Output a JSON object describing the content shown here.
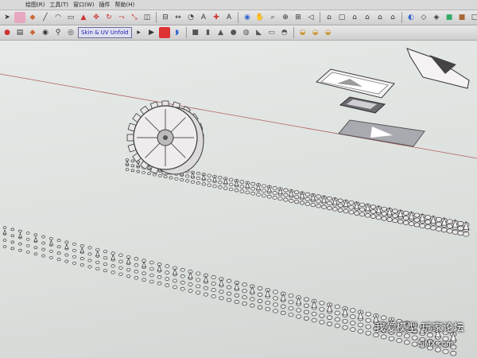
{
  "menubar": {
    "items": [
      "绘图(R)",
      "工具(T)",
      "窗口(W)",
      "插件",
      "帮助(H)"
    ]
  },
  "toolbar": {
    "unfold_label": "Skin & UV Unfold"
  },
  "watermark": {
    "text": "我爱模型 玩家论坛",
    "url": "5iMX.com"
  },
  "colors": {
    "toolbar_bg": "#d4d4d4",
    "viewport_bg": "#e1e5e2",
    "model_fill": "#e8e6e6",
    "model_stroke": "#3a3a3a",
    "axis_red": "#b06060"
  }
}
